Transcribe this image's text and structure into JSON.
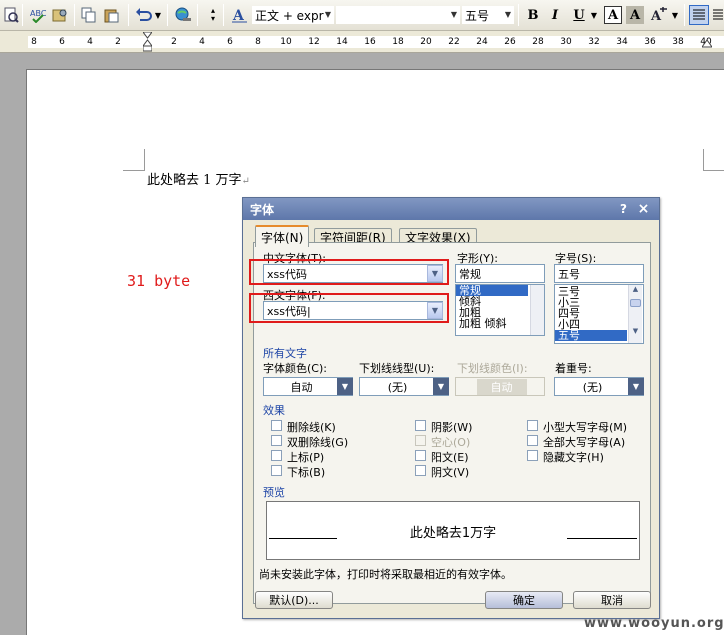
{
  "toolbar": {
    "style": "正文 + expr",
    "font": "",
    "size": "五号",
    "bold": "B",
    "italic": "I",
    "underline": "U",
    "char_border": "A",
    "char_shading": "A"
  },
  "ruler": {
    "numbers": [
      "8",
      "6",
      "4",
      "2",
      "",
      "2",
      "4",
      "6",
      "8",
      "10",
      "12",
      "14",
      "16",
      "18",
      "20",
      "22",
      "24",
      "26",
      "28",
      "30",
      "32",
      "34",
      "36",
      "38",
      "40"
    ]
  },
  "document": {
    "text": "此处略去 1 万字",
    "annotation": "31 byte"
  },
  "dialog": {
    "title": "字体",
    "help": "?",
    "close": "×",
    "tabs": [
      "字体(N)",
      "字符间距(R)",
      "文字效果(X)"
    ],
    "chinese_font_label": "中文字体(T):",
    "chinese_font_value": "xss代码",
    "western_font_label": "西文字体(F):",
    "western_font_value": "xss代码|",
    "style_label": "字形(Y):",
    "style_value": "常规",
    "style_options": [
      "常规",
      "倾斜",
      "加粗",
      "加粗 倾斜"
    ],
    "size_label": "字号(S):",
    "size_value": "五号",
    "size_options": [
      "三号",
      "小三",
      "四号",
      "小四",
      "五号"
    ],
    "all_text_header": "所有文字",
    "font_color_label": "字体颜色(C):",
    "font_color_value": "自动",
    "underline_type_label": "下划线线型(U):",
    "underline_type_value": "(无)",
    "underline_color_label": "下划线颜色(I):",
    "underline_color_value": "自动",
    "emphasis_label": "着重号:",
    "emphasis_value": "(无)",
    "effects_header": "效果",
    "effects": {
      "strikethrough": "删除线(K)",
      "double_strikethrough": "双删除线(G)",
      "superscript": "上标(P)",
      "subscript": "下标(B)",
      "shadow": "阴影(W)",
      "outline": "空心(O)",
      "emboss": "阳文(E)",
      "engrave": "阴文(V)",
      "small_caps": "小型大写字母(M)",
      "all_caps": "全部大写字母(A)",
      "hidden": "隐藏文字(H)"
    },
    "preview_header": "预览",
    "preview_text": "此处略去1万字",
    "note": "尚未安装此字体，打印时将采取最相近的有效字体。",
    "default_button": "默认(D)...",
    "ok_button": "确定",
    "cancel_button": "取消"
  },
  "watermark": "www.wooyun.org",
  "colors": {
    "accent_red": "#e01b1b",
    "title_blue": "#6a80b4",
    "selection": "#316ac5"
  }
}
